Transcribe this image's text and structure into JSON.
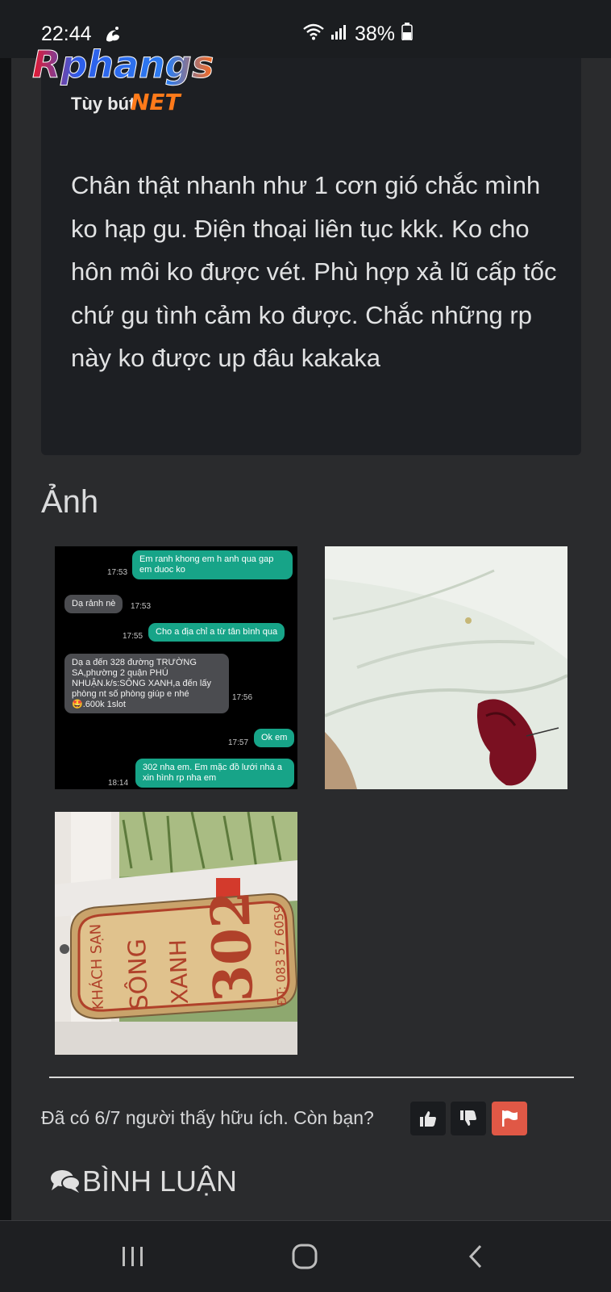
{
  "status_bar": {
    "time": "22:44",
    "battery": "38%"
  },
  "logo": {
    "main": "Rphangs",
    "sub": "NET"
  },
  "review": {
    "label": "Tùy bút",
    "body": "Chân thật nhanh như 1 cơn gió chắc mình ko hạp gu. Điện thoại liên tục kkk. Ko cho hôn môi ko được vét. Phù hợp xả lũ cấp tốc chứ gu tình cảm ko được. Chắc những rp này ko được up đâu kakaka"
  },
  "photos_section": {
    "title": "Ảnh",
    "chat": {
      "messages": [
        {
          "dir": "out",
          "text": "Em ranh khong em h anh qua gap em duoc ko",
          "time": "17:53"
        },
        {
          "dir": "in",
          "text": "Dạ rảnh nè",
          "time": "17:53"
        },
        {
          "dir": "out",
          "text": "Cho a địa chỉ a từ tân bình qua",
          "time": "17:55"
        },
        {
          "dir": "in",
          "text": "Dạ a đến 328 đường TRƯỜNG SA,phường 2 quận PHÚ NHUẬN.k/s:SÔNG XANH,a đến lấy phòng nt số phòng giúp e nhé 🤩.600k 1slot",
          "time": "17:56"
        },
        {
          "dir": "out",
          "text": "Ok em",
          "time": "17:57"
        },
        {
          "dir": "out",
          "text": "302 nha em. Em mặc đồ lưới nhá a xin hình rp nha em",
          "time": "18:14"
        }
      ]
    },
    "key_tag": {
      "line1": "KHÁCH SẠN",
      "line2": "SÔNG",
      "line3": "XANH",
      "room": "302",
      "phone": "ĐT: 083 57 6059"
    }
  },
  "feedback": {
    "text": "Đã có 6/7 người thấy hữu ích. Còn bạn?"
  },
  "comments": {
    "title": "BÌNH LUẬN"
  },
  "colors": {
    "background": "#2a2b2d",
    "card": "#1d1f23",
    "flag": "#e05846",
    "chat_out": "#17a488"
  }
}
